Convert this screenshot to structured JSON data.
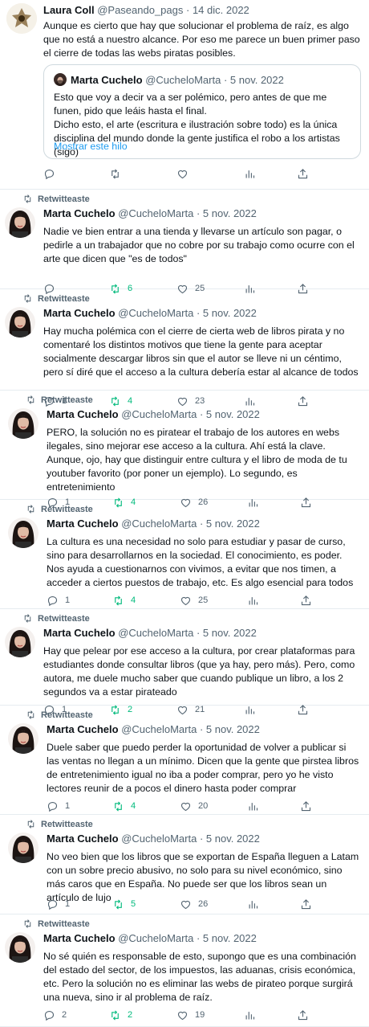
{
  "icons": {
    "retweet": "retweet-icon",
    "reply": "reply-icon",
    "like": "heart-icon",
    "views": "bar-chart-icon",
    "share": "share-icon"
  },
  "colors": {
    "text": "#0f1419",
    "secondary": "#536471",
    "link": "#1d9bf0",
    "retweet_green": "#00ba7c",
    "divider": "#e6ecf0"
  },
  "top_tweet": {
    "name": "Laura Coll",
    "handle": "@Paseando_pags",
    "date": "· 14 dic. 2022",
    "text": "Aunque es cierto que hay que solucionar el problema de raíz, es algo que no está a nuestro alcance. Por eso me parece un buen primer paso el cierre de todas las webs piratas posibles.",
    "quote": {
      "name": "Marta Cuchelo",
      "handle": "@CucheloMarta",
      "date": "· 5 nov. 2022",
      "line1": "Esto que voy a decir va a ser polémico, pero antes de que me funen, pido que leáis hasta el final.",
      "line2": "Dicho esto, el arte (escritura e ilustración sobre todo) es la única disciplina del mundo donde la gente justifica el robo a los artistas (sigo)",
      "show_thread": "Mostrar este hilo"
    }
  },
  "retweet_label": "Retwitteaste",
  "tweets": [
    {
      "name": "Marta Cuchelo",
      "handle": "@CucheloMarta",
      "date": "· 5 nov. 2022",
      "text": "Nadie ve bien entrar a una tienda y llevarse un artículo son pagar, o pedirle a un trabajador que no cobre por su trabajo como ocurre con el arte que dicen que \"es de todos\"",
      "replies": "",
      "retweets": "6",
      "likes": "25"
    },
    {
      "name": "Marta Cuchelo",
      "handle": "@CucheloMarta",
      "date": "· 5 nov. 2022",
      "text": "Hay mucha polémica con el cierre de cierta web de libros pirata y no comentaré los distintos motivos que tiene la gente para aceptar socialmente descargar libros sin que el autor se lleve ni un céntimo, pero sí diré que el acceso a la cultura debería estar al alcance de todos",
      "replies": "1",
      "retweets": "4",
      "likes": "23"
    },
    {
      "name": "Marta Cuchelo",
      "handle": "@CucheloMarta",
      "date": "· 5 nov. 2022",
      "text": "PERO, la solución no es piratear el trabajo de los autores en webs ilegales, sino mejorar ese acceso a la cultura. Ahí está la clave. Aunque, ojo, hay que distinguir entre cultura y el libro de moda de tu youtuber favorito (por poner un ejemplo). Lo segundo, es entretenimiento",
      "replies": "1",
      "retweets": "4",
      "likes": "26"
    },
    {
      "name": "Marta Cuchelo",
      "handle": "@CucheloMarta",
      "date": "· 5 nov. 2022",
      "text": "La cultura es una necesidad no solo para estudiar y pasar de curso, sino para desarrollarnos en la sociedad. El conocimiento, es poder. Nos ayuda a cuestionarnos con vivimos, a evitar que nos timen, a acceder a ciertos puestos de trabajo, etc. Es algo esencial para todos",
      "replies": "1",
      "retweets": "4",
      "likes": "25"
    },
    {
      "name": "Marta Cuchelo",
      "handle": "@CucheloMarta",
      "date": "· 5 nov. 2022",
      "text": "Hay que pelear por ese acceso a la cultura, por crear plataformas para estudiantes donde consultar libros (que ya hay, pero más). Pero, como autora, me duele mucho saber que cuando publique un libro, a los 2 segundos va a estar pirateado",
      "replies": "1",
      "retweets": "2",
      "likes": "21"
    },
    {
      "name": "Marta Cuchelo",
      "handle": "@CucheloMarta",
      "date": "· 5 nov. 2022",
      "text": "Duele saber que puedo perder la oportunidad de volver a publicar si las ventas no llegan a un mínimo. Dicen que la gente que pirstea libros de entretenimiento igual no iba a poder comprar, pero yo he visto lectores reunir de a pocos el dinero hasta poder comprar",
      "replies": "1",
      "retweets": "4",
      "likes": "20"
    },
    {
      "name": "Marta Cuchelo",
      "handle": "@CucheloMarta",
      "date": "· 5 nov. 2022",
      "text": "No veo bien que los libros que se exportan de España lleguen a Latam con un sobre precio abusivo, no solo para su nivel económico, sino más caros que en España. No puede ser que los libros sean un artículo de lujo",
      "replies": "1",
      "retweets": "5",
      "likes": "26"
    },
    {
      "name": "Marta Cuchelo",
      "handle": "@CucheloMarta",
      "date": "· 5 nov. 2022",
      "text": "No sé quién es responsable de esto, supongo que es una combinación del estado del sector, de los impuestos, las aduanas, crisis económica, etc. Pero la solución no es eliminar las webs de pirateo porque surgirá una nueva, sino ir al problema de raíz.",
      "replies": "2",
      "retweets": "2",
      "likes": "19"
    }
  ]
}
